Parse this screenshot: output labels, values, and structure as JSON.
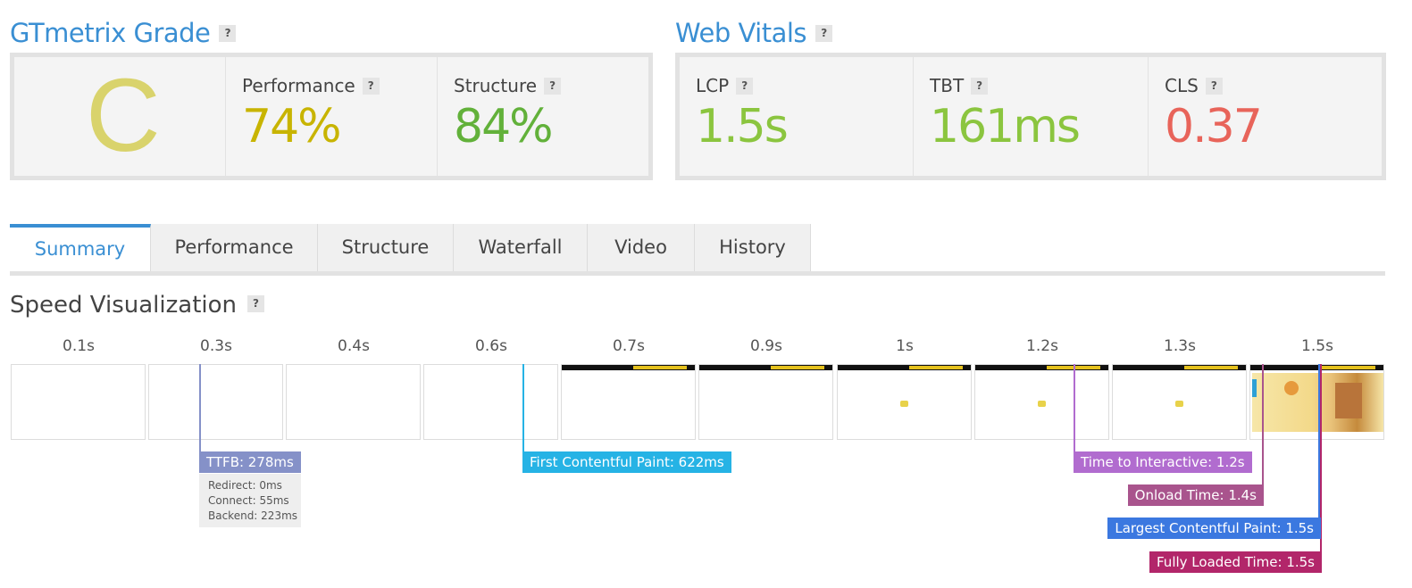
{
  "grade_section": {
    "title": "GTmetrix Grade",
    "help": "?",
    "grade": "C",
    "performance_label": "Performance",
    "performance_value": "74%",
    "structure_label": "Structure",
    "structure_value": "84%"
  },
  "vitals_section": {
    "title": "Web Vitals",
    "help": "?",
    "lcp_label": "LCP",
    "lcp_value": "1.5s",
    "tbt_label": "TBT",
    "tbt_value": "161ms",
    "cls_label": "CLS",
    "cls_value": "0.37"
  },
  "tabs": [
    {
      "label": "Summary"
    },
    {
      "label": "Performance"
    },
    {
      "label": "Structure"
    },
    {
      "label": "Waterfall"
    },
    {
      "label": "Video"
    },
    {
      "label": "History"
    }
  ],
  "speed": {
    "title": "Speed Visualization",
    "help": "?",
    "times": [
      "0.1s",
      "0.3s",
      "0.4s",
      "0.6s",
      "0.7s",
      "0.9s",
      "1s",
      "1.2s",
      "1.3s",
      "1.5s"
    ],
    "ttfb": "TTFB: 278ms",
    "redirect": "Redirect: 0ms",
    "connect": "Connect: 55ms",
    "backend": "Backend: 223ms",
    "fcp": "First Contentful Paint: 622ms",
    "tti": "Time to Interactive: 1.2s",
    "onload": "Onload Time: 1.4s",
    "lcp": "Largest Contentful Paint: 1.5s",
    "fully_loaded": "Fully Loaded Time: 1.5s"
  },
  "colors": {
    "accent": "#3a8fd3",
    "performance": "#c8b400",
    "good": "#8bc53f",
    "structure": "#62b13a",
    "bad": "#e8645a",
    "ttfb": "#8591c8",
    "fcp": "#26b3e5",
    "tti": "#b16ccf",
    "onload": "#a9548d",
    "lcp": "#3b78e0",
    "fully_loaded": "#b2266a"
  }
}
